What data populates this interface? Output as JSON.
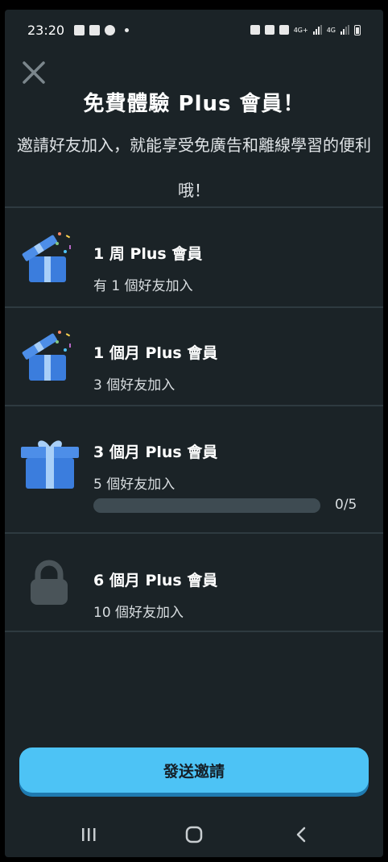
{
  "status_bar": {
    "time": "23:20",
    "network_1": "4G+",
    "network_2": "4G"
  },
  "header": {
    "title": "免費體驗 Plus 會員！",
    "subtitle": "邀請好友加入，就能享受免廣告和離線學習的便利哦！"
  },
  "rewards": [
    {
      "title": "1 周 Plus 會員",
      "requirement": "有 1 個好友加入",
      "icon": "open-gift-icon"
    },
    {
      "title": "1 個月 Plus 會員",
      "requirement": "3 個好友加入",
      "icon": "open-gift-icon"
    },
    {
      "title": "3 個月 Plus 會員",
      "requirement": "5 個好友加入",
      "icon": "gift-box-icon",
      "progress": {
        "current": 0,
        "total": 5,
        "label": "0/5"
      }
    },
    {
      "title": "6 個月 Plus 會員",
      "requirement": "10 個好友加入",
      "icon": "lock-icon"
    }
  ],
  "actions": {
    "send_invite": "發送邀請"
  },
  "colors": {
    "background": "#1b2327",
    "accent": "#4dc3f5",
    "gift_blue": "#3b7ddd",
    "lock_gray": "#4a5459"
  }
}
